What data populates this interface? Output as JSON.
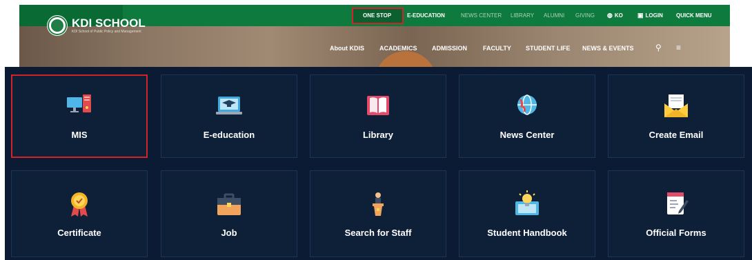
{
  "header": {
    "utility_links": [
      {
        "label": "ONE STOP"
      },
      {
        "label": "E-EDUCATION"
      },
      {
        "label": "NEWS CENTER"
      },
      {
        "label": "LIBRARY"
      },
      {
        "label": "ALUMNI"
      },
      {
        "label": "GIVING"
      },
      {
        "label": "KO",
        "icon": "globe-icon"
      },
      {
        "label": "LOGIN",
        "icon": "login-icon"
      },
      {
        "label": "QUICK MENU"
      }
    ],
    "logo": {
      "name": "KDI SCHOOL",
      "subtitle": "KDI School of Public Policy and Management"
    },
    "nav": [
      "About KDIS",
      "ACADEMICS",
      "ADMISSION",
      "FACULTY",
      "STUDENT LIFE",
      "NEWS & EVENTS"
    ],
    "icons": {
      "search": "search-icon",
      "menu": "hamburger-menu-icon"
    },
    "colors": {
      "bar": "#0f7a3d",
      "highlight": "#d2232a"
    }
  },
  "quick_menu": {
    "rows": [
      [
        {
          "label": "MIS",
          "icon": "monitor-computer-icon",
          "selected": true
        },
        {
          "label": "E-education",
          "icon": "laptop-graduation-cap-icon"
        },
        {
          "label": "Library",
          "icon": "open-book-icon"
        },
        {
          "label": "News Center",
          "icon": "globe-news-icon"
        },
        {
          "label": "Create Email",
          "icon": "envelope-letter-icon"
        }
      ],
      [
        {
          "label": "Certificate",
          "icon": "award-ribbon-icon"
        },
        {
          "label": "Job",
          "icon": "briefcase-icon"
        },
        {
          "label": "Search for Staff",
          "icon": "person-at-podium-icon"
        },
        {
          "label": "Student Handbook",
          "icon": "lightbulb-book-icon"
        },
        {
          "label": "Official Forms",
          "icon": "document-pen-icon"
        }
      ]
    ],
    "colors": {
      "panel": "#0b1b33",
      "tile": "#0e2038",
      "selected_border": "#d2232a"
    }
  }
}
